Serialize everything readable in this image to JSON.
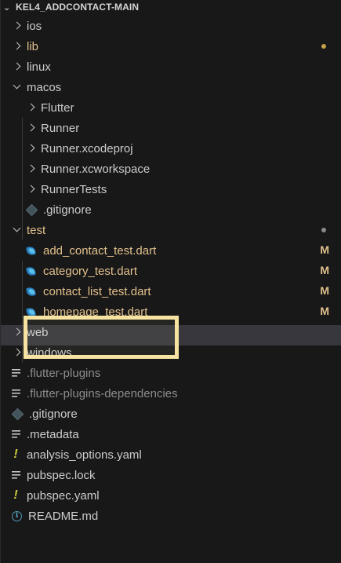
{
  "explorer": {
    "title": "KEL4_ADDCONTACT-MAIN"
  },
  "items": [
    {
      "label": "ios",
      "type": "folder",
      "state": "closed",
      "depth": 0,
      "color": "#cccccc"
    },
    {
      "label": "lib",
      "type": "folder",
      "state": "closed",
      "depth": 0,
      "color": "#e2c08d",
      "dot": "#c4a24a"
    },
    {
      "label": "linux",
      "type": "folder",
      "state": "closed",
      "depth": 0,
      "color": "#cccccc"
    },
    {
      "label": "macos",
      "type": "folder",
      "state": "open",
      "depth": 0,
      "color": "#cccccc"
    },
    {
      "label": "Flutter",
      "type": "folder",
      "state": "closed",
      "depth": 1,
      "color": "#cccccc"
    },
    {
      "label": "Runner",
      "type": "folder",
      "state": "closed",
      "depth": 1,
      "color": "#cccccc"
    },
    {
      "label": "Runner.xcodeproj",
      "type": "folder",
      "state": "closed",
      "depth": 1,
      "color": "#cccccc"
    },
    {
      "label": "Runner.xcworkspace",
      "type": "folder",
      "state": "closed",
      "depth": 1,
      "color": "#cccccc"
    },
    {
      "label": "RunnerTests",
      "type": "folder",
      "state": "closed",
      "depth": 1,
      "color": "#cccccc"
    },
    {
      "label": ".gitignore",
      "type": "git-file",
      "depth": 1,
      "color": "#cccccc"
    },
    {
      "label": "test",
      "type": "folder",
      "state": "open",
      "depth": 0,
      "color": "#e2c08d",
      "dot": "#8a8a8a"
    },
    {
      "label": "add_contact_test.dart",
      "type": "dart-file",
      "depth": 1,
      "color": "#e2c08d",
      "badge": "M"
    },
    {
      "label": "category_test.dart",
      "type": "dart-file",
      "depth": 1,
      "color": "#e2c08d",
      "badge": "M"
    },
    {
      "label": "contact_list_test.dart",
      "type": "dart-file",
      "depth": 1,
      "color": "#e2c08d",
      "badge": "M"
    },
    {
      "label": "homepage_test.dart",
      "type": "dart-file",
      "depth": 1,
      "color": "#e2c08d",
      "badge": "M",
      "selected": true
    },
    {
      "label": "web",
      "type": "folder",
      "state": "closed",
      "depth": 0,
      "color": "#cccccc"
    },
    {
      "label": "windows",
      "type": "folder",
      "state": "closed",
      "depth": 0,
      "color": "#cccccc"
    },
    {
      "label": ".flutter-plugins",
      "type": "lines-file",
      "depth": 0,
      "color": "#8c8c8c"
    },
    {
      "label": ".flutter-plugins-dependencies",
      "type": "lines-file",
      "depth": 0,
      "color": "#8c8c8c"
    },
    {
      "label": ".gitignore",
      "type": "git-file",
      "depth": 0,
      "color": "#cccccc"
    },
    {
      "label": ".metadata",
      "type": "lines-file",
      "depth": 0,
      "color": "#cccccc"
    },
    {
      "label": "analysis_options.yaml",
      "type": "yaml-file",
      "depth": 0,
      "color": "#cccccc"
    },
    {
      "label": "pubspec.lock",
      "type": "lines-file",
      "depth": 0,
      "color": "#cccccc"
    },
    {
      "label": "pubspec.yaml",
      "type": "yaml-file",
      "depth": 0,
      "color": "#cccccc"
    },
    {
      "label": "README.md",
      "type": "info-file",
      "depth": 0,
      "color": "#cccccc"
    }
  ]
}
